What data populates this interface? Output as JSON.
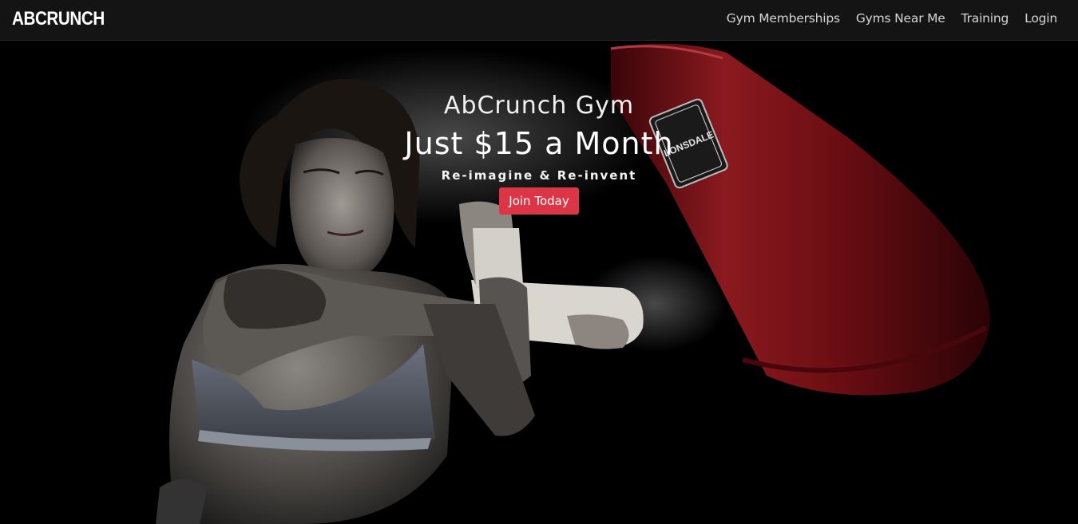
{
  "navbar": {
    "brand": "ABCRUNCH",
    "links": [
      "Gym Memberships",
      "Gyms Near Me",
      "Training",
      "Login"
    ]
  },
  "hero": {
    "subtitle": "AbCrunch Gym",
    "title": "Just $15 a Month",
    "tagline": "Re-imagine & Re-invent",
    "cta_label": "Join Today",
    "bag_label": "LONSDALE"
  },
  "colors": {
    "navbar_bg": "#141414",
    "cta": "#dc3545",
    "bag": "#7a0f14"
  }
}
